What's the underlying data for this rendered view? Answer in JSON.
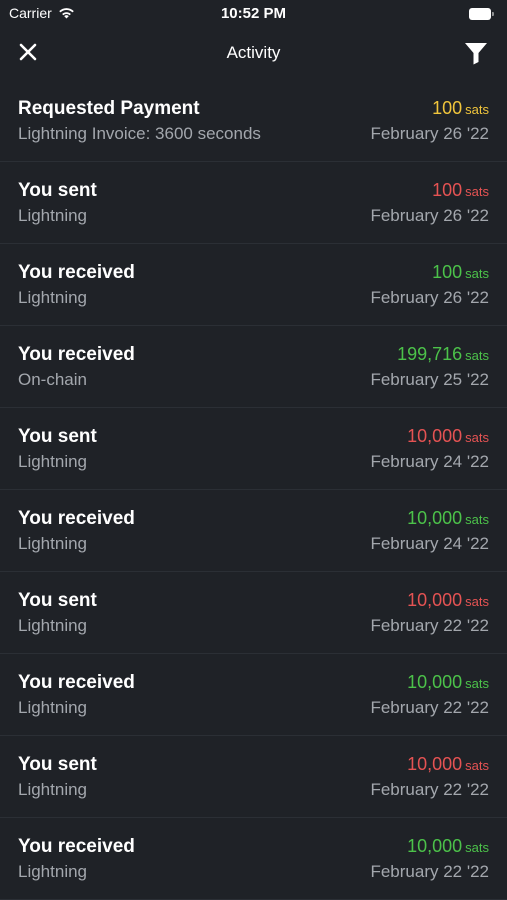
{
  "status_bar": {
    "carrier": "Carrier",
    "time": "10:52 PM"
  },
  "nav": {
    "title": "Activity",
    "close_icon": "close-icon",
    "filter_icon": "filter-icon"
  },
  "colors": {
    "background": "#1f2227",
    "pending": "#f0c53c",
    "sent": "#e55353",
    "received": "#4cc24a",
    "secondary_text": "#a3a7ad"
  },
  "activities": [
    {
      "title": "Requested Payment",
      "subtitle": "Lightning Invoice: 3600 seconds",
      "amount": "100",
      "unit": "sats",
      "date": "February 26 '22",
      "status": "pending"
    },
    {
      "title": "You sent",
      "subtitle": "Lightning",
      "amount": "100",
      "unit": "sats",
      "date": "February 26 '22",
      "status": "sent"
    },
    {
      "title": "You received",
      "subtitle": "Lightning",
      "amount": "100",
      "unit": "sats",
      "date": "February 26 '22",
      "status": "received"
    },
    {
      "title": "You received",
      "subtitle": "On-chain",
      "amount": "199,716",
      "unit": "sats",
      "date": "February 25 '22",
      "status": "received"
    },
    {
      "title": "You sent",
      "subtitle": "Lightning",
      "amount": "10,000",
      "unit": "sats",
      "date": "February 24 '22",
      "status": "sent"
    },
    {
      "title": "You received",
      "subtitle": "Lightning",
      "amount": "10,000",
      "unit": "sats",
      "date": "February 24 '22",
      "status": "received"
    },
    {
      "title": "You sent",
      "subtitle": "Lightning",
      "amount": "10,000",
      "unit": "sats",
      "date": "February 22 '22",
      "status": "sent"
    },
    {
      "title": "You received",
      "subtitle": "Lightning",
      "amount": "10,000",
      "unit": "sats",
      "date": "February 22 '22",
      "status": "received"
    },
    {
      "title": "You sent",
      "subtitle": "Lightning",
      "amount": "10,000",
      "unit": "sats",
      "date": "February 22 '22",
      "status": "sent"
    },
    {
      "title": "You received",
      "subtitle": "Lightning",
      "amount": "10,000",
      "unit": "sats",
      "date": "February 22 '22",
      "status": "received"
    }
  ]
}
